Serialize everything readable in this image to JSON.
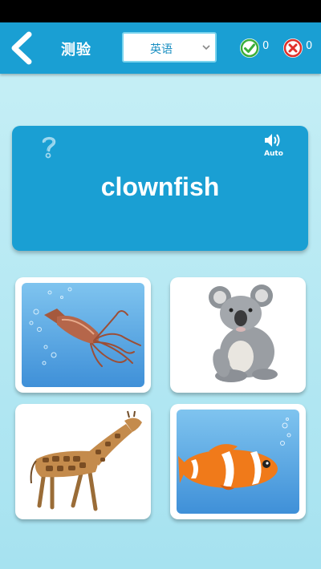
{
  "header": {
    "title": "测验",
    "language_selected": "英语",
    "correct_count": "0",
    "wrong_count": "0"
  },
  "card": {
    "word": "clownfish",
    "audio_label": "Auto"
  },
  "options": [
    {
      "animal": "squid",
      "background": "blue"
    },
    {
      "animal": "koala",
      "background": "white"
    },
    {
      "animal": "giraffe",
      "background": "white"
    },
    {
      "animal": "clownfish",
      "background": "blue"
    }
  ],
  "colors": {
    "primary": "#1a9fd3",
    "correct": "#3cae3a",
    "wrong": "#e0312b"
  }
}
